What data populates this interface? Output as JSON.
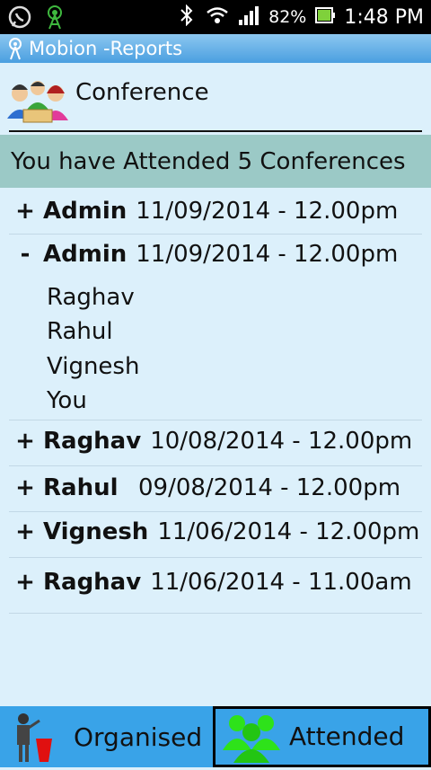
{
  "status_bar": {
    "battery": "82%",
    "time": "1:48 PM"
  },
  "app": {
    "title": "Mobion -Reports"
  },
  "header": {
    "title": "Conference"
  },
  "summary": "You have Attended 5 Conferences",
  "conferences": [
    {
      "sign": "+",
      "host": "Admin",
      "datetime": "11/09/2014 - 12.00pm",
      "expanded": false
    },
    {
      "sign": "-",
      "host": "Admin",
      "datetime": "11/09/2014 - 12.00pm",
      "expanded": true,
      "members": [
        "Raghav",
        "Rahul",
        "Vignesh",
        "You"
      ]
    },
    {
      "sign": "+",
      "host": "Raghav",
      "datetime": "10/08/2014 - 12.00pm",
      "expanded": false
    },
    {
      "sign": "+",
      "host": "Rahul",
      "datetime": "09/08/2014 - 12.00pm",
      "expanded": false
    },
    {
      "sign": "+",
      "host": "Vignesh",
      "datetime": "11/06/2014 - 12.00pm",
      "expanded": false
    },
    {
      "sign": "+",
      "host": "Raghav",
      "datetime": "11/06/2014 - 11.00am",
      "expanded": false
    }
  ],
  "tabs": {
    "organised": "Organised",
    "attended": "Attended"
  },
  "colors": {
    "background": "#dcf0fb",
    "summary_bg": "#9bc9c6",
    "tab_bg": "#39a3e8",
    "title_bar": "#4a9fe0"
  }
}
